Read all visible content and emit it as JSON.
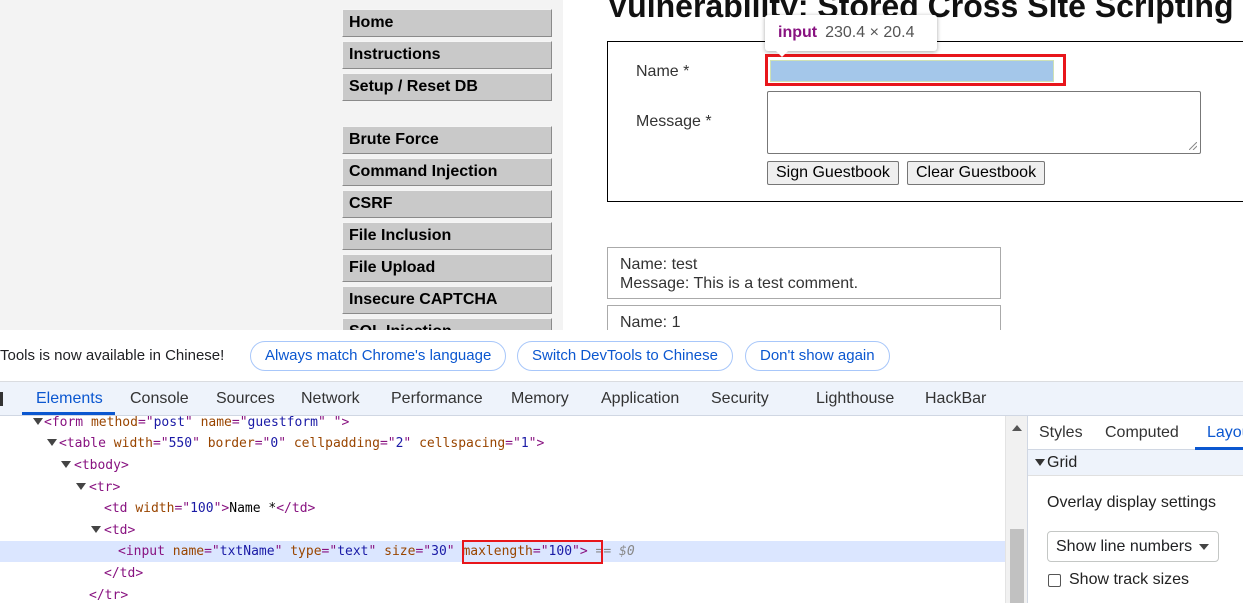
{
  "page": {
    "title": "Vulnerability: Stored Cross Site Scripting",
    "nav_items": [
      "Home",
      "Instructions",
      "Setup / Reset DB",
      "Brute Force",
      "Command Injection",
      "CSRF",
      "File Inclusion",
      "File Upload",
      "Insecure CAPTCHA",
      "SQL Injection"
    ],
    "form": {
      "name_label": "Name *",
      "message_label": "Message *",
      "sign_button": "Sign Guestbook",
      "clear_button": "Clear Guestbook"
    },
    "tooltip": {
      "tag": "input",
      "size": "230.4 × 20.4"
    },
    "comments": [
      {
        "name": "Name: test",
        "message": "Message: This is a test comment."
      },
      {
        "name": "Name: 1",
        "message": ""
      }
    ]
  },
  "infobar": {
    "text": "Tools is now available in Chinese!",
    "buttons": [
      "Always match Chrome's language",
      "Switch DevTools to Chinese",
      "Don't show again"
    ]
  },
  "devtools": {
    "tabs": [
      "Elements",
      "Console",
      "Sources",
      "Network",
      "Performance",
      "Memory",
      "Application",
      "Security",
      "Lighthouse",
      "HackBar"
    ],
    "active_tab": "Elements",
    "tree": {
      "form": {
        "tag": "form",
        "attrs": [
          [
            "method",
            "post"
          ],
          [
            "name",
            "guestform"
          ]
        ]
      },
      "table": {
        "tag": "table",
        "attrs": [
          [
            "width",
            "550"
          ],
          [
            "border",
            "0"
          ],
          [
            "cellpadding",
            "2"
          ],
          [
            "cellspacing",
            "1"
          ]
        ]
      },
      "tbody": "tbody",
      "tr": "tr",
      "td_name": {
        "attr": "width",
        "val": "100",
        "text": "Name *"
      },
      "td": "td",
      "input": {
        "tag": "input",
        "attrs": [
          [
            "name",
            "txtName"
          ],
          [
            "type",
            "text"
          ],
          [
            "size",
            "30"
          ]
        ],
        "highlight_attr": [
          "maxlength",
          "100"
        ],
        "marker": "== $0"
      },
      "td_close": "td",
      "tr_close": "tr"
    },
    "side": {
      "tabs": [
        "Styles",
        "Computed",
        "Layout"
      ],
      "active_tab": "Layout",
      "section": "Grid",
      "overlay_label": "Overlay display settings",
      "select_value": "Show line numbers",
      "checkbox_label": "Show track sizes"
    }
  }
}
